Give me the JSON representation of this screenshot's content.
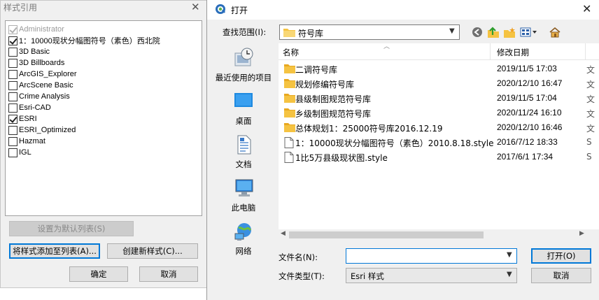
{
  "style_dialog": {
    "title": "样式引用",
    "items": [
      {
        "label": "Administrator",
        "checked": true,
        "disabled": true
      },
      {
        "label": "1：10000现状分幅图符号（素色）西北院",
        "checked": true,
        "disabled": false
      },
      {
        "label": "3D Basic",
        "checked": false,
        "disabled": false
      },
      {
        "label": "3D Billboards",
        "checked": false,
        "disabled": false
      },
      {
        "label": "ArcGIS_Explorer",
        "checked": false,
        "disabled": false
      },
      {
        "label": "ArcScene Basic",
        "checked": false,
        "disabled": false
      },
      {
        "label": "Crime Analysis",
        "checked": false,
        "disabled": false
      },
      {
        "label": "Esri-CAD",
        "checked": false,
        "disabled": false
      },
      {
        "label": "ESRI",
        "checked": true,
        "disabled": false
      },
      {
        "label": "ESRI_Optimized",
        "checked": false,
        "disabled": false
      },
      {
        "label": "Hazmat",
        "checked": false,
        "disabled": false
      },
      {
        "label": "IGL",
        "checked": false,
        "disabled": false
      }
    ],
    "set_default_label": "设置为默认列表(S)",
    "add_style_label": "将样式添加至列表(A)...",
    "create_style_label": "创建新样式(C)...",
    "ok_label": "确定",
    "cancel_label": "取消"
  },
  "open_dialog": {
    "title": "打开",
    "lookin_label": "查找范围(I):",
    "lookin_value": "符号库",
    "places": [
      {
        "label": "最近使用的项目",
        "icon": "recent-icon"
      },
      {
        "label": "桌面",
        "icon": "desktop-icon"
      },
      {
        "label": "文档",
        "icon": "documents-icon"
      },
      {
        "label": "此电脑",
        "icon": "computer-icon"
      },
      {
        "label": "网络",
        "icon": "network-icon"
      }
    ],
    "columns": {
      "name": "名称",
      "date": "修改日期"
    },
    "files": [
      {
        "name": "二调符号库",
        "date": "2019/11/5 17:03",
        "type": "folder",
        "extra": "文"
      },
      {
        "name": "规划修编符号库",
        "date": "2020/12/10 16:47",
        "type": "folder",
        "extra": "文"
      },
      {
        "name": "县级制图规范符号库",
        "date": "2019/11/5 17:04",
        "type": "folder",
        "extra": "文"
      },
      {
        "name": "乡级制图规范符号库",
        "date": "2020/11/24 16:10",
        "type": "folder",
        "extra": "文"
      },
      {
        "name": "总体规划1：25000符号库2016.12.19",
        "date": "2020/12/10 16:46",
        "type": "folder",
        "extra": "文"
      },
      {
        "name": "1：10000现状分幅图符号（素色）2010.8.18.style",
        "date": "2016/7/12 18:33",
        "type": "file",
        "extra": "S"
      },
      {
        "name": "1比5万县级现状图.style",
        "date": "2017/6/1 17:34",
        "type": "file",
        "extra": "S"
      }
    ],
    "filename_label": "文件名(N):",
    "filename_value": "",
    "filetype_label": "文件类型(T):",
    "filetype_value": "Esri 样式",
    "open_label": "打开(O)",
    "cancel_label": "取消"
  },
  "colors": {
    "folder": "#f5c342",
    "accent": "#0078d7"
  }
}
